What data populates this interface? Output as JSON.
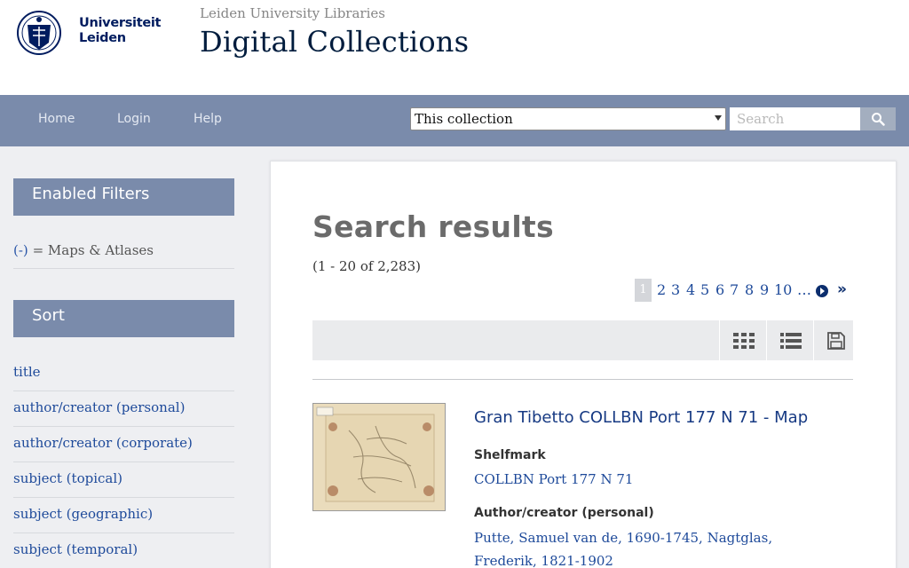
{
  "header": {
    "logo_text_line1": "Universiteit",
    "logo_text_line2": "Leiden",
    "library_name": "Leiden University Libraries",
    "site_title": "Digital Collections"
  },
  "nav": {
    "items": [
      "Home",
      "Login",
      "Help"
    ],
    "scope_selected": "This collection",
    "search_placeholder": "Search",
    "search_icon": "search-icon"
  },
  "sidebar": {
    "filters_heading": "Enabled Filters",
    "filter": {
      "remove_label": "(-)",
      "text": "= Maps & Atlases"
    },
    "sort_heading": "Sort",
    "sort_items": [
      "title",
      "author/creator (personal)",
      "author/creator (corporate)",
      "subject (topical)",
      "subject (geographic)",
      "subject (temporal)"
    ]
  },
  "results": {
    "title": "Search results",
    "count": "(1 - 20 of 2,283)",
    "pages": [
      "1",
      "2",
      "3",
      "4",
      "5",
      "6",
      "7",
      "8",
      "9",
      "10",
      "…"
    ],
    "current_page": "1",
    "toolbar_icons": [
      "grid-view-icon",
      "list-view-icon",
      "save-icon"
    ],
    "items": [
      {
        "title": "Gran Tibetto COLLBN Port 177 N 71 - Map",
        "fields": [
          {
            "label": "Shelfmark",
            "value": "COLLBN Port 177 N 71"
          },
          {
            "label": "Author/creator (personal)",
            "value": "Putte, Samuel van de, 1690-1745, Nagtglas, Frederik, 1821-1902"
          }
        ]
      }
    ]
  },
  "colors": {
    "navbar": "#7a8bab",
    "link": "#1e4a9a",
    "title_dark": "#001c3d"
  }
}
